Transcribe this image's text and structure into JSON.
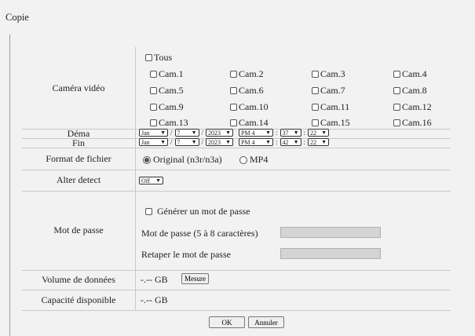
{
  "page": {
    "title": "Copie"
  },
  "camera": {
    "label": "Caméra vidéo",
    "all_label": "Tous",
    "cams": [
      "Cam.1",
      "Cam.2",
      "Cam.3",
      "Cam.4",
      "Cam.5",
      "Cam.6",
      "Cam.7",
      "Cam.8",
      "Cam.9",
      "Cam.10",
      "Cam.11",
      "Cam.12",
      "Cam.13",
      "Cam.14",
      "Cam.15",
      "Cam.16"
    ]
  },
  "start": {
    "label": "Déma",
    "month": "Jan",
    "day": "7",
    "year": "2023",
    "ampm_hour": "PM 4",
    "minute": "37",
    "second": "22"
  },
  "end": {
    "label": "Fin",
    "month": "Jan",
    "day": "7",
    "year": "2023",
    "ampm_hour": "PM 4",
    "minute": "42",
    "second": "22"
  },
  "format": {
    "label": "Format de fichier",
    "options": [
      "Original (n3r/n3a)",
      "MP4"
    ],
    "selected": "Original (n3r/n3a)"
  },
  "alter": {
    "label": "Alter detect",
    "value": "Off"
  },
  "password": {
    "label": "Mot de passe",
    "generate_label": "Générer un mot de passe",
    "field_label": "Mot de passe (5 à 8 caractères)",
    "retype_label": "Retaper le mot de passe"
  },
  "volume": {
    "label": "Volume de données",
    "value": "-.-- GB",
    "button": "Mesure"
  },
  "capacity": {
    "label": "Capacité disponible",
    "value": "-.-- GB"
  },
  "actions": {
    "ok": "OK",
    "cancel": "Annuler"
  },
  "separators": {
    "slash": "/",
    "colon": ":"
  }
}
